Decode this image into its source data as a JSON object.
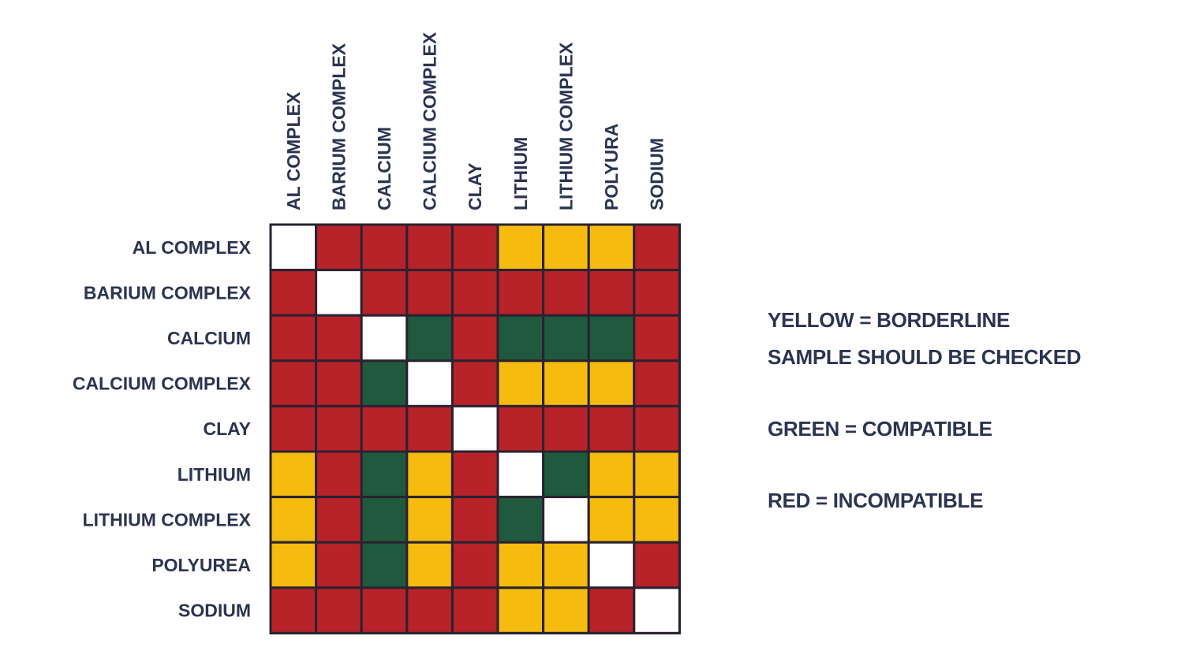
{
  "chart_data": {
    "type": "heatmap",
    "title": "",
    "row_labels": [
      "AL COMPLEX",
      "BARIUM COMPLEX",
      "CALCIUM",
      "CALCIUM COMPLEX",
      "CLAY",
      "LITHIUM",
      "LITHIUM COMPLEX",
      "POLYUREA",
      "SODIUM"
    ],
    "column_labels": [
      "AL COMPLEX",
      "BARIUM COMPLEX",
      "CALCIUM",
      "CALCIUM COMPLEX",
      "CLAY",
      "LITHIUM",
      "LITHIUM COMPLEX",
      "POLYURA",
      "SODIUM"
    ],
    "categories": {
      "N": {
        "meaning": "same (diagonal)",
        "color": "#ffffff"
      },
      "R": {
        "meaning": "INCOMPATIBLE",
        "color": "#b82229"
      },
      "Y": {
        "meaning": "BORDERLINE",
        "color": "#f5bb0e"
      },
      "G": {
        "meaning": "COMPATIBLE",
        "color": "#1f5a3e"
      }
    },
    "matrix": [
      [
        "N",
        "R",
        "R",
        "R",
        "R",
        "Y",
        "Y",
        "Y",
        "R"
      ],
      [
        "R",
        "N",
        "R",
        "R",
        "R",
        "R",
        "R",
        "R",
        "R"
      ],
      [
        "R",
        "R",
        "N",
        "G",
        "R",
        "G",
        "G",
        "G",
        "R"
      ],
      [
        "R",
        "R",
        "G",
        "N",
        "R",
        "Y",
        "Y",
        "Y",
        "R"
      ],
      [
        "R",
        "R",
        "R",
        "R",
        "N",
        "R",
        "R",
        "R",
        "R"
      ],
      [
        "Y",
        "R",
        "G",
        "Y",
        "R",
        "N",
        "G",
        "Y",
        "Y"
      ],
      [
        "Y",
        "R",
        "G",
        "Y",
        "R",
        "G",
        "N",
        "Y",
        "Y"
      ],
      [
        "Y",
        "R",
        "G",
        "Y",
        "R",
        "Y",
        "Y",
        "N",
        "R"
      ],
      [
        "R",
        "R",
        "R",
        "R",
        "R",
        "Y",
        "Y",
        "R",
        "N"
      ]
    ],
    "legend": [
      "YELLOW = BORDERLINE",
      "SAMPLE SHOULD BE CHECKED",
      "GREEN = COMPATIBLE",
      "RED = INCOMPATIBLE"
    ],
    "legend_placement": "right"
  }
}
